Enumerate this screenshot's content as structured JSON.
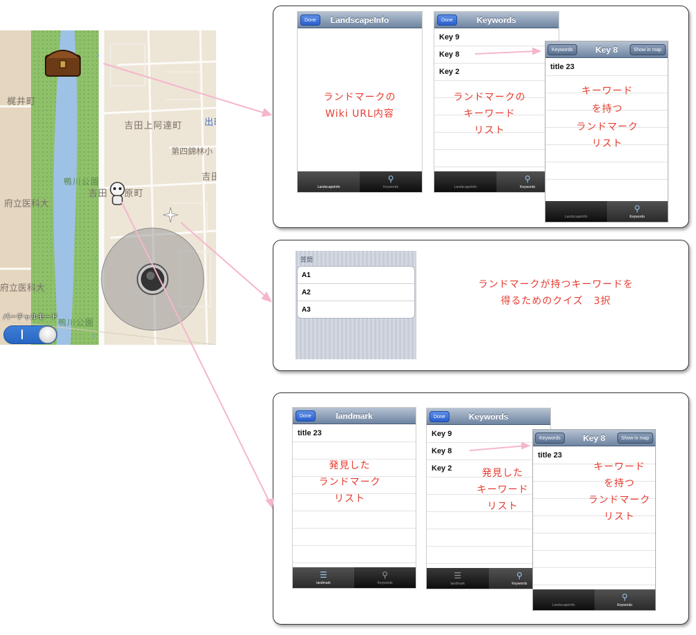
{
  "map": {
    "labels": {
      "kajii": "梶井町",
      "yoshida_kamiadachi": "吉田上阿達町",
      "demachi": "出町",
      "daishi_nishikirin": "第四錦林小",
      "yoshida_hara": "吉田",
      "kamogawa_park": "鴨川公園",
      "yoshida_kawara": "吉田",
      "hara_cho": "原町",
      "furitsu_ika": "府立医科大",
      "furitsu_ika2": "府立医科大",
      "kamogawa_park2": "鴨川公園",
      "virtual_mode": "バーチャルモード"
    },
    "toggle_state": "on"
  },
  "panel1": {
    "phone1": {
      "done": "Done",
      "title": "LandscapeInfo",
      "note": [
        "ランドマークの",
        "Wiki URL内容"
      ],
      "tabs": [
        "LandscapeInfo",
        "Keywords"
      ]
    },
    "phone2": {
      "done": "Done",
      "title": "Keywords",
      "rows": [
        "Key 9",
        "Key 8",
        "Key 2"
      ],
      "note": [
        "ランドマークの",
        "キーワード",
        "リスト"
      ],
      "tabs": [
        "LandscapeInfo",
        "Keywords"
      ]
    },
    "phone3": {
      "back": "Keywords",
      "title": "Key 8",
      "show": "Show in map",
      "rows": [
        "title 23"
      ],
      "note": [
        "キーワード",
        "を持つ",
        "ランドマーク",
        "リスト"
      ],
      "tabs": [
        "LandscapeInfo",
        "Keywords"
      ]
    }
  },
  "panel2": {
    "header": "質問",
    "answers": [
      "A1",
      "A2",
      "A3"
    ],
    "note": [
      "ランドマークが持つキーワードを",
      "得るためのクイズ　3択"
    ]
  },
  "panel3": {
    "phone1": {
      "done": "Done",
      "title": "landmark",
      "rows": [
        "title 23"
      ],
      "note": [
        "発見した",
        "ランドマーク",
        "リスト"
      ],
      "tabs": [
        "landmark",
        "Keywords"
      ]
    },
    "phone2": {
      "done": "Done",
      "title": "Keywords",
      "rows": [
        "Key 9",
        "Key 8",
        "Key 2"
      ],
      "note": [
        "発見した",
        "キーワード",
        "リスト"
      ],
      "tabs": [
        "landmark",
        "Keywords"
      ]
    },
    "phone3": {
      "back": "Keywords",
      "title": "Key 8",
      "show": "Show in map",
      "rows": [
        "title 23"
      ],
      "note": [
        "キーワード",
        "を持つ",
        "ランドマーク",
        "リスト"
      ],
      "tabs": [
        "LandscapeInfo",
        "Keywords"
      ]
    }
  },
  "colors": {
    "annotation": "#e63a2e",
    "connector": "#f4b6cc",
    "navbar": "#6e84a1",
    "river": "#9ec2e6"
  }
}
